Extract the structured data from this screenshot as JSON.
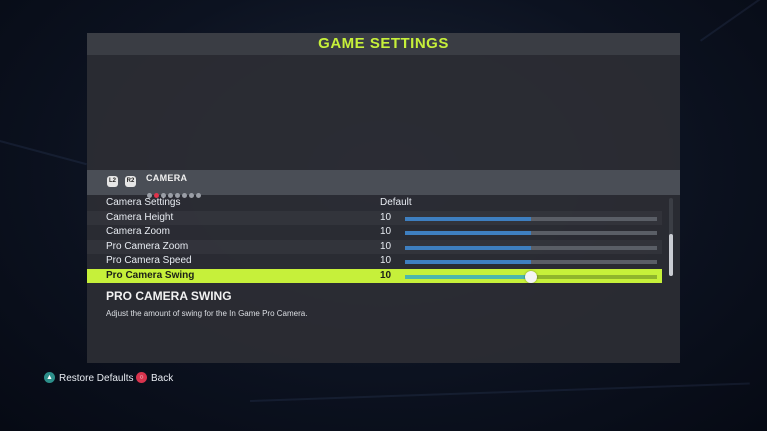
{
  "window": {
    "title": "GAME SETTINGS"
  },
  "section": {
    "title": "CAMERA",
    "left_bumper": "L2",
    "right_bumper": "R2",
    "pages_total": 8,
    "page_active": 2
  },
  "settings": {
    "rows": [
      {
        "label": "Camera Settings",
        "value": "Default",
        "slider": null
      },
      {
        "label": "Camera Height",
        "value": "10",
        "slider": 0.5
      },
      {
        "label": "Camera Zoom",
        "value": "10",
        "slider": 0.5
      },
      {
        "label": "Pro Camera Zoom",
        "value": "10",
        "slider": 0.5
      },
      {
        "label": "Pro Camera Speed",
        "value": "10",
        "slider": 0.5
      },
      {
        "label": "Pro Camera Swing",
        "value": "10",
        "slider": 0.5,
        "selected": true
      }
    ]
  },
  "description": {
    "title": "PRO CAMERA SWING",
    "text": "Adjust the amount of swing for the In Game Pro Camera."
  },
  "footer": {
    "restore_label": "Restore Defaults",
    "back_label": "Back",
    "restore_icon": "triangle-button-icon",
    "back_icon": "circle-button-icon"
  },
  "colors": {
    "accent": "#c6f03a",
    "slider_fill": "#3e7fc0",
    "selected_slider_fill": "#4db6ac"
  }
}
